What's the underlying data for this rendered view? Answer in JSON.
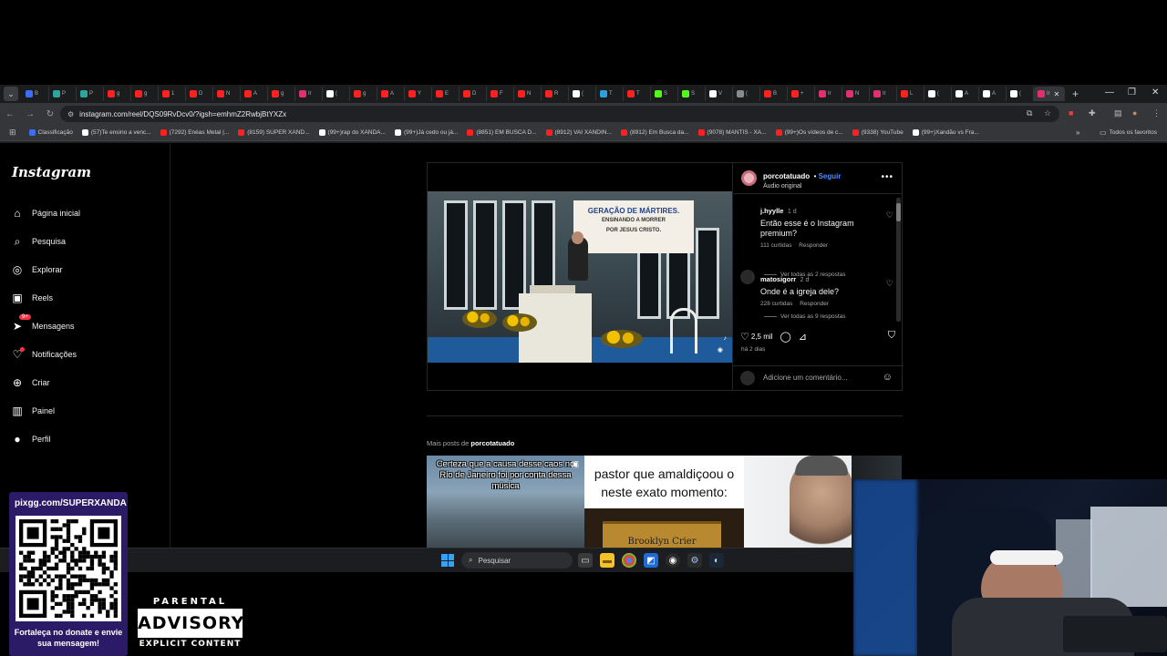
{
  "browser": {
    "url": "instagram.com/reel/DQS09RvDcv0/?igsh=emhmZ2RwbjBtYXZx",
    "tabs": [
      {
        "label": "B",
        "color": "#3b6ef5"
      },
      {
        "label": "P",
        "color": "#2aa8a0"
      },
      {
        "label": "P",
        "color": "#2aa8a0"
      },
      {
        "label": "g",
        "color": "#ff2020"
      },
      {
        "label": "g",
        "color": "#ff2020"
      },
      {
        "label": "1",
        "color": "#ff2020"
      },
      {
        "label": "D",
        "color": "#ff2020"
      },
      {
        "label": "N",
        "color": "#ff2020"
      },
      {
        "label": "A",
        "color": "#ff2020"
      },
      {
        "label": "g",
        "color": "#ff2020"
      },
      {
        "label": "Ir",
        "color": "#e1306c"
      },
      {
        "label": "(",
        "color": "#ffffff"
      },
      {
        "label": "g",
        "color": "#ff2020"
      },
      {
        "label": "A",
        "color": "#ff2020"
      },
      {
        "label": "Y",
        "color": "#ff2020"
      },
      {
        "label": "E",
        "color": "#ff2020"
      },
      {
        "label": "D",
        "color": "#ff2020"
      },
      {
        "label": "F",
        "color": "#ff2020"
      },
      {
        "label": "N",
        "color": "#ff2020"
      },
      {
        "label": "R",
        "color": "#ff2020"
      },
      {
        "label": "(",
        "color": "#ffffff"
      },
      {
        "label": "T",
        "color": "#2aa1de"
      },
      {
        "label": "T",
        "color": "#ff2020"
      },
      {
        "label": "S",
        "color": "#53fc18"
      },
      {
        "label": "S",
        "color": "#53fc18"
      },
      {
        "label": "V",
        "color": "#ffffff"
      },
      {
        "label": "(",
        "color": "#8a8a8a"
      },
      {
        "label": "B",
        "color": "#ff2020"
      },
      {
        "label": "+",
        "color": "#ff2020"
      },
      {
        "label": "Ir",
        "color": "#e1306c"
      },
      {
        "label": "N",
        "color": "#e1306c"
      },
      {
        "label": "Ir",
        "color": "#e1306c"
      },
      {
        "label": "L",
        "color": "#ff2020"
      },
      {
        "label": "(",
        "color": "#ffffff"
      },
      {
        "label": "A",
        "color": "#ffffff"
      },
      {
        "label": "A",
        "color": "#ffffff"
      },
      {
        "label": "(",
        "color": "#ffffff"
      },
      {
        "label": "Ir",
        "color": "#e1306c"
      }
    ],
    "bookmarks": [
      {
        "label": "Classificação",
        "color": "#3b6ef5"
      },
      {
        "label": "(57)Te ensino a venc...",
        "color": "#ffffff"
      },
      {
        "label": "(7292) Enéas Metal |...",
        "color": "#ff2020"
      },
      {
        "label": "(8159) SUPER XAND...",
        "color": "#ff2020"
      },
      {
        "label": "(99+)rap do XANDÃ...",
        "color": "#ffffff"
      },
      {
        "label": "(99+)Já cedo ou já...",
        "color": "#ffffff"
      },
      {
        "label": "(8851) EM BUSCA D...",
        "color": "#ff2020"
      },
      {
        "label": "(8912) VAI XANDIN...",
        "color": "#ff2020"
      },
      {
        "label": "(8912) Em Busca da...",
        "color": "#ff2020"
      },
      {
        "label": "(9078) MANTIS - XA...",
        "color": "#ff2020"
      },
      {
        "label": "(99+)Os vídeos de c...",
        "color": "#ff2020"
      },
      {
        "label": "(9338) YouTube",
        "color": "#ff2020"
      },
      {
        "label": "(99+)Xandão vs Fra...",
        "color": "#ffffff"
      }
    ],
    "all_bookmarks": "Todos os favoritos"
  },
  "sidebar": {
    "logo": "Instagram",
    "items": [
      {
        "label": "Página inicial",
        "icon": "home-icon",
        "glyph": "⌂"
      },
      {
        "label": "Pesquisa",
        "icon": "search-icon",
        "glyph": "⌕"
      },
      {
        "label": "Explorar",
        "icon": "explore-icon",
        "glyph": "◎"
      },
      {
        "label": "Reels",
        "icon": "reels-icon",
        "glyph": "▣"
      },
      {
        "label": "Mensagens",
        "icon": "messages-icon",
        "glyph": "➤"
      },
      {
        "label": "Notificações",
        "icon": "heart-icon",
        "glyph": "♡"
      },
      {
        "label": "Criar",
        "icon": "create-icon",
        "glyph": "⊕"
      },
      {
        "label": "Painel",
        "icon": "dashboard-icon",
        "glyph": "▥"
      },
      {
        "label": "Perfil",
        "icon": "profile-icon",
        "glyph": "●"
      }
    ],
    "messages_badge": "9+"
  },
  "post": {
    "username": "porcotatuado",
    "follow": "Seguir",
    "audio": "Áudio original",
    "video": {
      "banner_line1": "GERAÇÃO DE MÁRTIRES.",
      "banner_line2": "ENSINANDO A MORRER",
      "banner_line3": "POR JESUS CRISTO."
    },
    "comments": [
      {
        "user": "j.hyylle",
        "time": "1 d",
        "text": "Então esse é o Instagram premium?",
        "likes": "111 curtidas",
        "reply": "Responder",
        "replies": "Ver todas as 2 respostas"
      },
      {
        "user": "matosigorr",
        "time": "2 d",
        "text": "Onde é a igreja dele?",
        "likes": "228 curtidas",
        "reply": "Responder",
        "replies": "Ver todas as 9 respostas"
      }
    ],
    "like_count": "2,5 mil",
    "posted_ago": "há 2 dias",
    "comment_placeholder": "Adicione um comentário..."
  },
  "more_posts": {
    "prefix": "Mais posts de",
    "username": "porcotatuado",
    "thumbs": [
      {
        "caption": "Certeza que a causa desse caos no Rio de Janeiro foi por conta dessa música"
      },
      {
        "caption": "pastor que amaldiçoou o neste exato momento:",
        "sign": "Brooklyn Crier"
      },
      {
        "caption": ""
      }
    ]
  },
  "taskbar": {
    "search_placeholder": "Pesquisar"
  },
  "overlay": {
    "qr_url": "pixgg.com/SUPERXANDA",
    "qr_caption": "Fortaleça no donate e envie sua mensagem!",
    "advisory_top": "PARENTAL",
    "advisory_mid": "ADVISORY",
    "advisory_bottom": "EXPLICIT CONTENT"
  }
}
